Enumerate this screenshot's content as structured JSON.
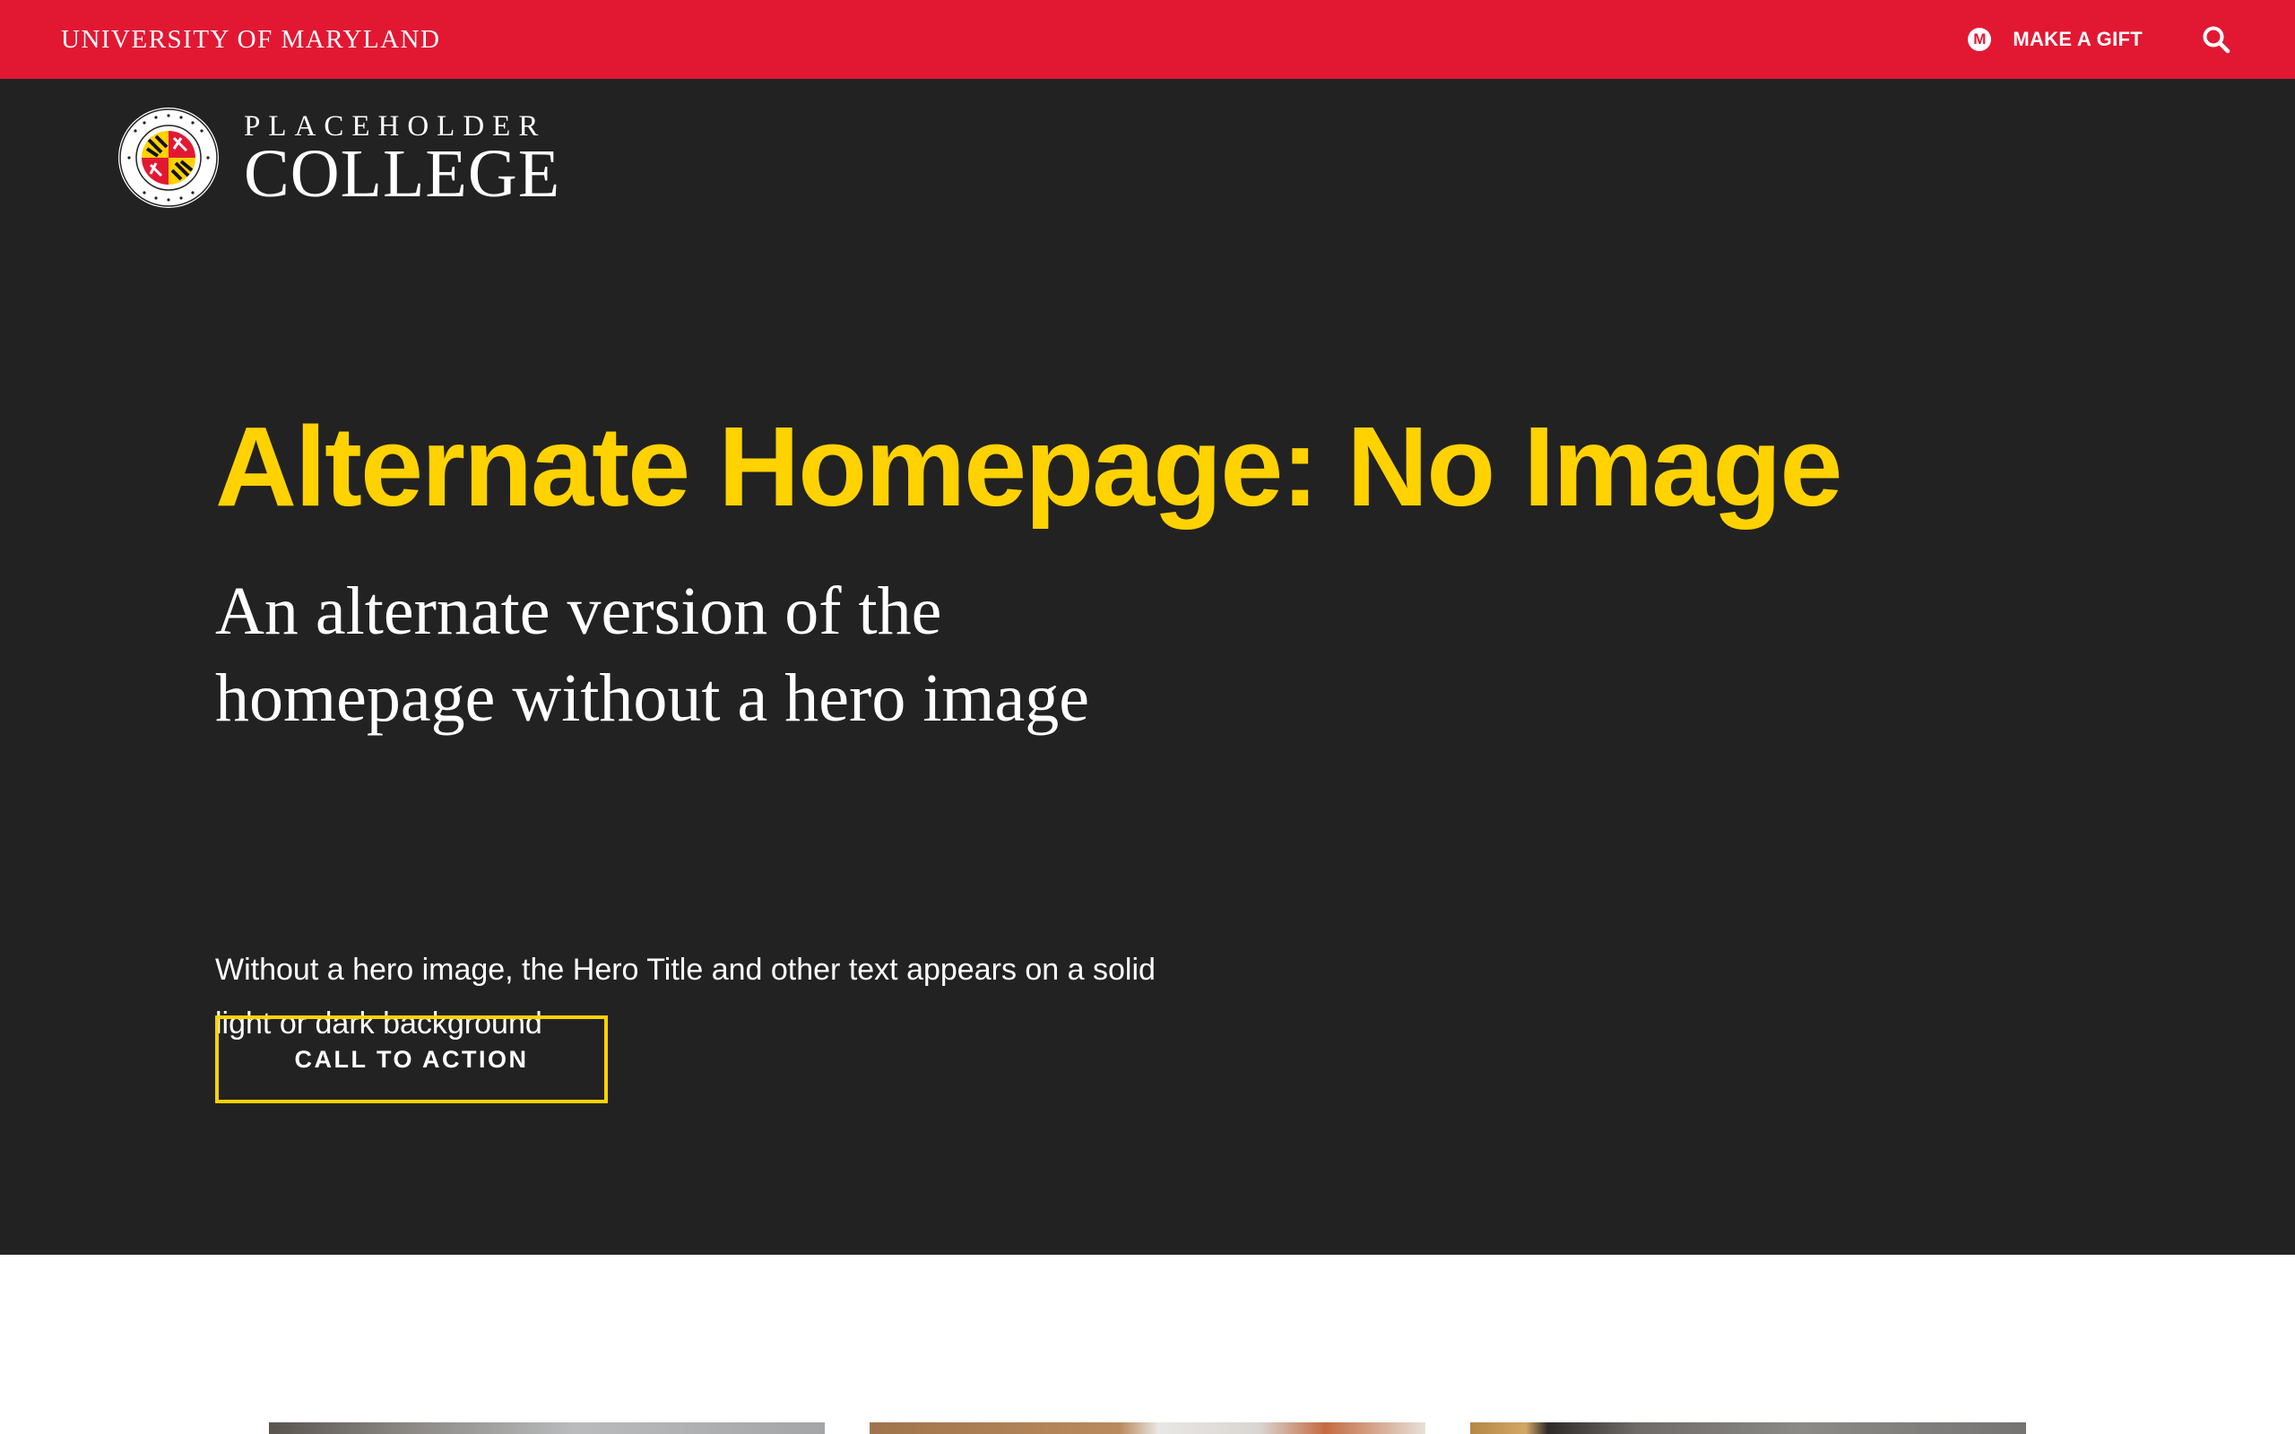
{
  "utility": {
    "wordmark": "UNIVERSITY OF MARYLAND",
    "gift_icon_glyph": "M",
    "gift_label": "MAKE A GIFT",
    "search_icon": "search-icon"
  },
  "brand": {
    "seal_icon": "umd-seal-icon",
    "top": "PLACEHOLDER",
    "bottom": "COLLEGE"
  },
  "hero": {
    "title": "Alternate Homepage: No Image",
    "subtitle": "An alternate version of the homepage without a hero image",
    "body": "Without a hero image, the Hero Title and other text appears on a solid light or dark background",
    "cta_label": "CALL TO ACTION"
  },
  "colors": {
    "utility_red": "#e21833",
    "hero_bg": "#222222",
    "accent_gold": "#ffd200",
    "text_white": "#ffffff"
  }
}
